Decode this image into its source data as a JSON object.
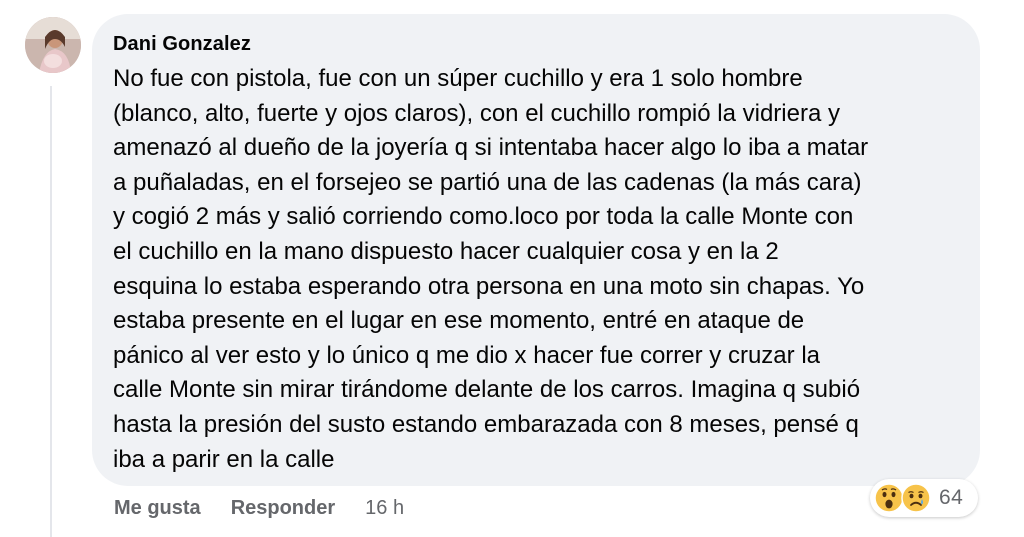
{
  "comment": {
    "author": "Dani Gonzalez",
    "text": "No fue con pistola, fue con un súper cuchillo y era 1 solo hombre\n(blanco, alto, fuerte y ojos claros), con el cuchillo rompió la vidriera y\namenazó al dueño de la joyería q si intentaba hacer algo lo iba a matar\na puñaladas, en el forsejeo se partió una de las cadenas (la más cara)\ny cogió 2 más y salió corriendo como.loco por toda la calle Monte con\nel cuchillo en la mano dispuesto hacer cualquier cosa y en la 2\nesquina lo estaba esperando otra persona en una moto sin chapas. Yo\nestaba presente en el lugar en ese momento, entré en ataque de\npánico al ver esto y lo único q me dio x hacer fue correr y cruzar la\ncalle Monte sin mirar tirándome delante de los carros. Imagina q subió\nhasta la presión del susto estando embarazada con 8 meses, pensé q\niba a parir en la calle"
  },
  "actions": {
    "like_label": "Me gusta",
    "reply_label": "Responder",
    "timestamp": "16 h"
  },
  "reactions": {
    "icons": [
      "wow-emoji-icon",
      "sad-emoji-icon"
    ],
    "count": "64"
  },
  "colors": {
    "bubble": "#f0f2f5",
    "text": "#050505",
    "secondary": "#65676b",
    "emoji_yellow": "#f7c34a"
  }
}
